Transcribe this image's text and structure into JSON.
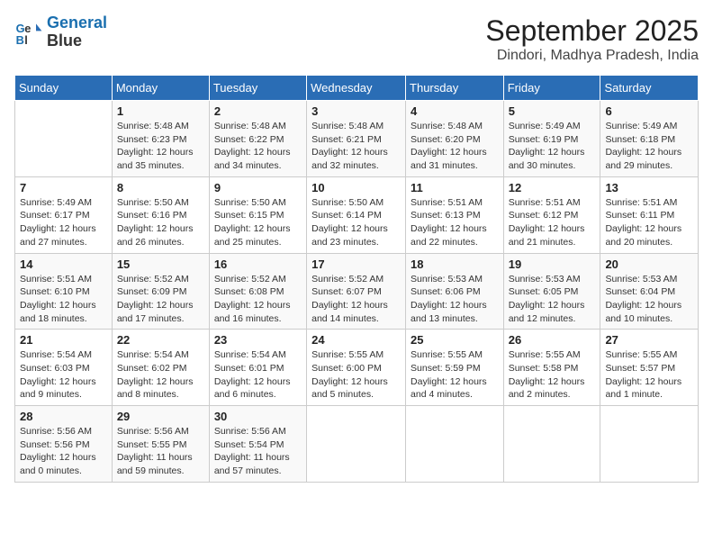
{
  "header": {
    "logo_line1": "General",
    "logo_line2": "Blue",
    "title": "September 2025",
    "subtitle": "Dindori, Madhya Pradesh, India"
  },
  "weekdays": [
    "Sunday",
    "Monday",
    "Tuesday",
    "Wednesday",
    "Thursday",
    "Friday",
    "Saturday"
  ],
  "weeks": [
    [
      {
        "day": "",
        "info": ""
      },
      {
        "day": "1",
        "info": "Sunrise: 5:48 AM\nSunset: 6:23 PM\nDaylight: 12 hours\nand 35 minutes."
      },
      {
        "day": "2",
        "info": "Sunrise: 5:48 AM\nSunset: 6:22 PM\nDaylight: 12 hours\nand 34 minutes."
      },
      {
        "day": "3",
        "info": "Sunrise: 5:48 AM\nSunset: 6:21 PM\nDaylight: 12 hours\nand 32 minutes."
      },
      {
        "day": "4",
        "info": "Sunrise: 5:48 AM\nSunset: 6:20 PM\nDaylight: 12 hours\nand 31 minutes."
      },
      {
        "day": "5",
        "info": "Sunrise: 5:49 AM\nSunset: 6:19 PM\nDaylight: 12 hours\nand 30 minutes."
      },
      {
        "day": "6",
        "info": "Sunrise: 5:49 AM\nSunset: 6:18 PM\nDaylight: 12 hours\nand 29 minutes."
      }
    ],
    [
      {
        "day": "7",
        "info": "Sunrise: 5:49 AM\nSunset: 6:17 PM\nDaylight: 12 hours\nand 27 minutes."
      },
      {
        "day": "8",
        "info": "Sunrise: 5:50 AM\nSunset: 6:16 PM\nDaylight: 12 hours\nand 26 minutes."
      },
      {
        "day": "9",
        "info": "Sunrise: 5:50 AM\nSunset: 6:15 PM\nDaylight: 12 hours\nand 25 minutes."
      },
      {
        "day": "10",
        "info": "Sunrise: 5:50 AM\nSunset: 6:14 PM\nDaylight: 12 hours\nand 23 minutes."
      },
      {
        "day": "11",
        "info": "Sunrise: 5:51 AM\nSunset: 6:13 PM\nDaylight: 12 hours\nand 22 minutes."
      },
      {
        "day": "12",
        "info": "Sunrise: 5:51 AM\nSunset: 6:12 PM\nDaylight: 12 hours\nand 21 minutes."
      },
      {
        "day": "13",
        "info": "Sunrise: 5:51 AM\nSunset: 6:11 PM\nDaylight: 12 hours\nand 20 minutes."
      }
    ],
    [
      {
        "day": "14",
        "info": "Sunrise: 5:51 AM\nSunset: 6:10 PM\nDaylight: 12 hours\nand 18 minutes."
      },
      {
        "day": "15",
        "info": "Sunrise: 5:52 AM\nSunset: 6:09 PM\nDaylight: 12 hours\nand 17 minutes."
      },
      {
        "day": "16",
        "info": "Sunrise: 5:52 AM\nSunset: 6:08 PM\nDaylight: 12 hours\nand 16 minutes."
      },
      {
        "day": "17",
        "info": "Sunrise: 5:52 AM\nSunset: 6:07 PM\nDaylight: 12 hours\nand 14 minutes."
      },
      {
        "day": "18",
        "info": "Sunrise: 5:53 AM\nSunset: 6:06 PM\nDaylight: 12 hours\nand 13 minutes."
      },
      {
        "day": "19",
        "info": "Sunrise: 5:53 AM\nSunset: 6:05 PM\nDaylight: 12 hours\nand 12 minutes."
      },
      {
        "day": "20",
        "info": "Sunrise: 5:53 AM\nSunset: 6:04 PM\nDaylight: 12 hours\nand 10 minutes."
      }
    ],
    [
      {
        "day": "21",
        "info": "Sunrise: 5:54 AM\nSunset: 6:03 PM\nDaylight: 12 hours\nand 9 minutes."
      },
      {
        "day": "22",
        "info": "Sunrise: 5:54 AM\nSunset: 6:02 PM\nDaylight: 12 hours\nand 8 minutes."
      },
      {
        "day": "23",
        "info": "Sunrise: 5:54 AM\nSunset: 6:01 PM\nDaylight: 12 hours\nand 6 minutes."
      },
      {
        "day": "24",
        "info": "Sunrise: 5:55 AM\nSunset: 6:00 PM\nDaylight: 12 hours\nand 5 minutes."
      },
      {
        "day": "25",
        "info": "Sunrise: 5:55 AM\nSunset: 5:59 PM\nDaylight: 12 hours\nand 4 minutes."
      },
      {
        "day": "26",
        "info": "Sunrise: 5:55 AM\nSunset: 5:58 PM\nDaylight: 12 hours\nand 2 minutes."
      },
      {
        "day": "27",
        "info": "Sunrise: 5:55 AM\nSunset: 5:57 PM\nDaylight: 12 hours\nand 1 minute."
      }
    ],
    [
      {
        "day": "28",
        "info": "Sunrise: 5:56 AM\nSunset: 5:56 PM\nDaylight: 12 hours\nand 0 minutes."
      },
      {
        "day": "29",
        "info": "Sunrise: 5:56 AM\nSunset: 5:55 PM\nDaylight: 11 hours\nand 59 minutes."
      },
      {
        "day": "30",
        "info": "Sunrise: 5:56 AM\nSunset: 5:54 PM\nDaylight: 11 hours\nand 57 minutes."
      },
      {
        "day": "",
        "info": ""
      },
      {
        "day": "",
        "info": ""
      },
      {
        "day": "",
        "info": ""
      },
      {
        "day": "",
        "info": ""
      }
    ]
  ]
}
